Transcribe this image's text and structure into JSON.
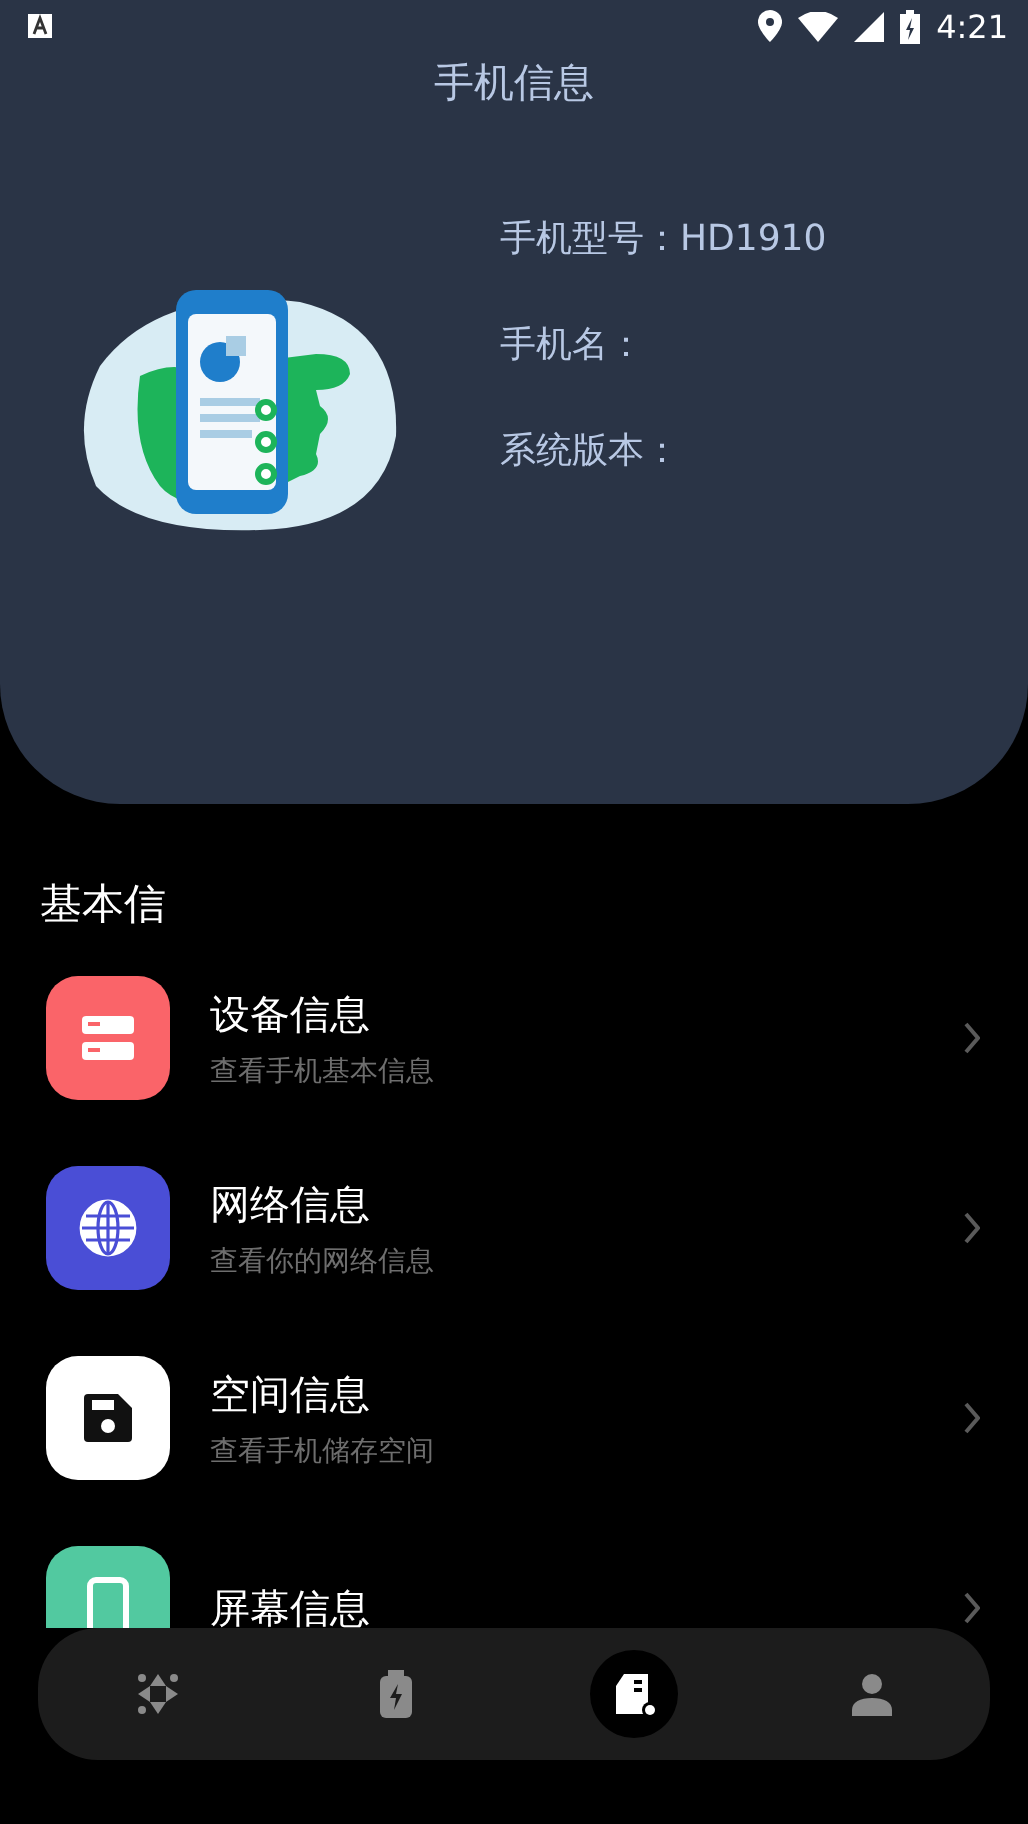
{
  "status_bar": {
    "time": "4:21"
  },
  "header": {
    "title": "手机信息",
    "info": [
      {
        "label": "手机型号：",
        "value": "HD1910"
      },
      {
        "label": "手机名："
      },
      {
        "label": "系统版本："
      }
    ]
  },
  "section_title": "基本信",
  "items": [
    {
      "kind": "storage",
      "color": "#fa6469",
      "title": "设备信息",
      "subtitle": "查看手机基本信息"
    },
    {
      "kind": "globe",
      "color": "#4a4ed6",
      "title": "网络信息",
      "subtitle": "查看你的网络信息"
    },
    {
      "kind": "floppy",
      "color": "#ffffff",
      "title": "空间信息",
      "subtitle": "查看手机储存空间"
    },
    {
      "kind": "phone",
      "color": "#52c9a0",
      "title": "屏幕信息"
    }
  ],
  "nav": [
    {
      "kind": "move",
      "selected": false
    },
    {
      "kind": "battery",
      "selected": false
    },
    {
      "kind": "card",
      "selected": true
    },
    {
      "kind": "person",
      "selected": false
    }
  ]
}
